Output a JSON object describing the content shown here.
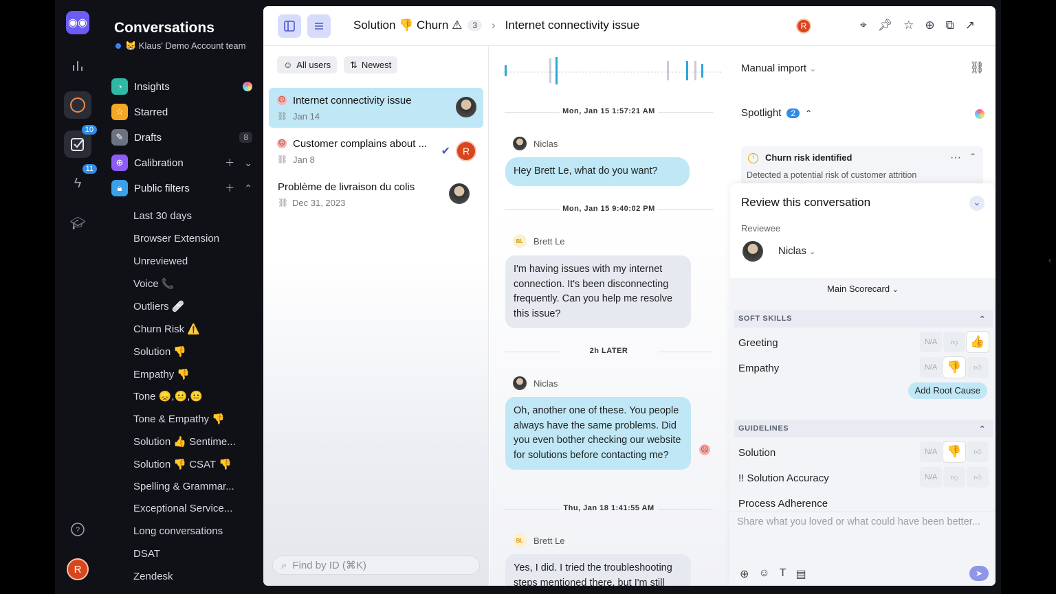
{
  "rail": {
    "badge_reviews": "10",
    "badge_tasks": "11",
    "avatar": "R"
  },
  "sidebar": {
    "title": "Conversations",
    "team": "😸 Klaus' Demo Account team",
    "nav": [
      {
        "label": "Insights",
        "icon": "insights-icon",
        "color": "#2fb8a4"
      },
      {
        "label": "Starred",
        "icon": "star-icon",
        "color": "#f5a623"
      },
      {
        "label": "Drafts",
        "icon": "pencil-icon",
        "color": "#6b7280",
        "count": "8"
      },
      {
        "label": "Calibration",
        "icon": "calibration-icon",
        "color": "#8b5cf6"
      },
      {
        "label": "Public filters",
        "icon": "lock-icon",
        "color": "#3aa0e8"
      }
    ],
    "filters": [
      "Last 30 days",
      "Browser Extension",
      "Unreviewed",
      "Voice 📞",
      "Outliers 🩹",
      "Churn Risk ⚠️",
      "Solution 👎",
      "Empathy 👎",
      "Tone 😞,😐,😐",
      "Tone & Empathy 👎",
      "Solution 👍 Sentime...",
      "Solution 👎 CSAT 👎",
      "Spelling & Grammar...",
      "Exceptional Service...",
      "Long conversations",
      "DSAT",
      "Zendesk"
    ]
  },
  "topbar": {
    "filter_name": "Solution 👎 Churn ⚠",
    "filter_count": "3",
    "conversation_title": "Internet connectivity issue",
    "avatar": "R"
  },
  "list": {
    "chip_users": "All users",
    "chip_sort": "Newest",
    "search_placeholder": "Find by ID (⌘K)",
    "items": [
      {
        "title": "Internet connectivity issue",
        "date": "Jan 14"
      },
      {
        "title": "Customer complains about ...",
        "date": "Jan 8",
        "avatar": "R"
      },
      {
        "title": "Problème de livraison du colis",
        "date": "Dec 31, 2023"
      }
    ]
  },
  "chat": {
    "sep1": "Mon, Jan 15 1:57:21 AM",
    "who1": "Niclas",
    "msg1": "Hey Brett Le, what do you want?",
    "sep2": "Mon, Jan 15 9:40:02 PM",
    "who2": "Brett Le",
    "msg2": "I'm having issues with my internet connection. It's been disconnecting frequently. Can you help me resolve this issue?",
    "sep3": "2h LATER",
    "who3": "Niclas",
    "msg3": "Oh, another one of these. You people always have the same problems. Did you even bother checking our website for solutions before contacting me?",
    "sep4": "Thu, Jan 18 1:41:55 AM",
    "who4": "Brett Le",
    "msg4": "Yes, I did. I tried the troubleshooting steps mentioned there, but I'm still",
    "bl": "BL"
  },
  "right": {
    "import": "Manual import",
    "spotlight": "Spotlight",
    "spotlight_count": "2",
    "alert_title": "Churn risk identified",
    "alert_text": "Detected a potential risk of customer attrition",
    "review_title": "Review this conversation",
    "reviewee_label": "Reviewee",
    "reviewee": "Niclas",
    "scorecard": "Main Scorecard",
    "sec1": "SOFT SKILLS",
    "greeting": "Greeting",
    "empathy": "Empathy",
    "root_cause": "Add Root Cause",
    "sec2": "GUIDELINES",
    "solution": "Solution",
    "accuracy": "!! Solution Accuracy",
    "process": "Process Adherence",
    "na": "N/A",
    "comment_placeholder": "Share what you loved or what could have been better..."
  }
}
